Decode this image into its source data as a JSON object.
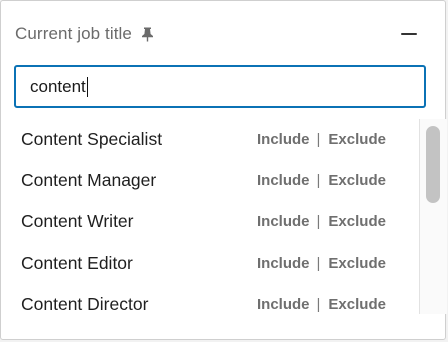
{
  "header": {
    "title": "Current job title"
  },
  "icons": {
    "pin": "pin-icon",
    "collapse": "minus-icon"
  },
  "search": {
    "value": "content"
  },
  "results": [
    {
      "label": "Content Specialist",
      "include": "Include",
      "separator": "|",
      "exclude": "Exclude"
    },
    {
      "label": "Content Manager",
      "include": "Include",
      "separator": "|",
      "exclude": "Exclude"
    },
    {
      "label": "Content Writer",
      "include": "Include",
      "separator": "|",
      "exclude": "Exclude"
    },
    {
      "label": "Content Editor",
      "include": "Include",
      "separator": "|",
      "exclude": "Exclude"
    },
    {
      "label": "Content Director",
      "include": "Include",
      "separator": "|",
      "exclude": "Exclude"
    }
  ],
  "colors": {
    "focus_border": "#0b72b5",
    "action_text": "#6f6f6f"
  }
}
